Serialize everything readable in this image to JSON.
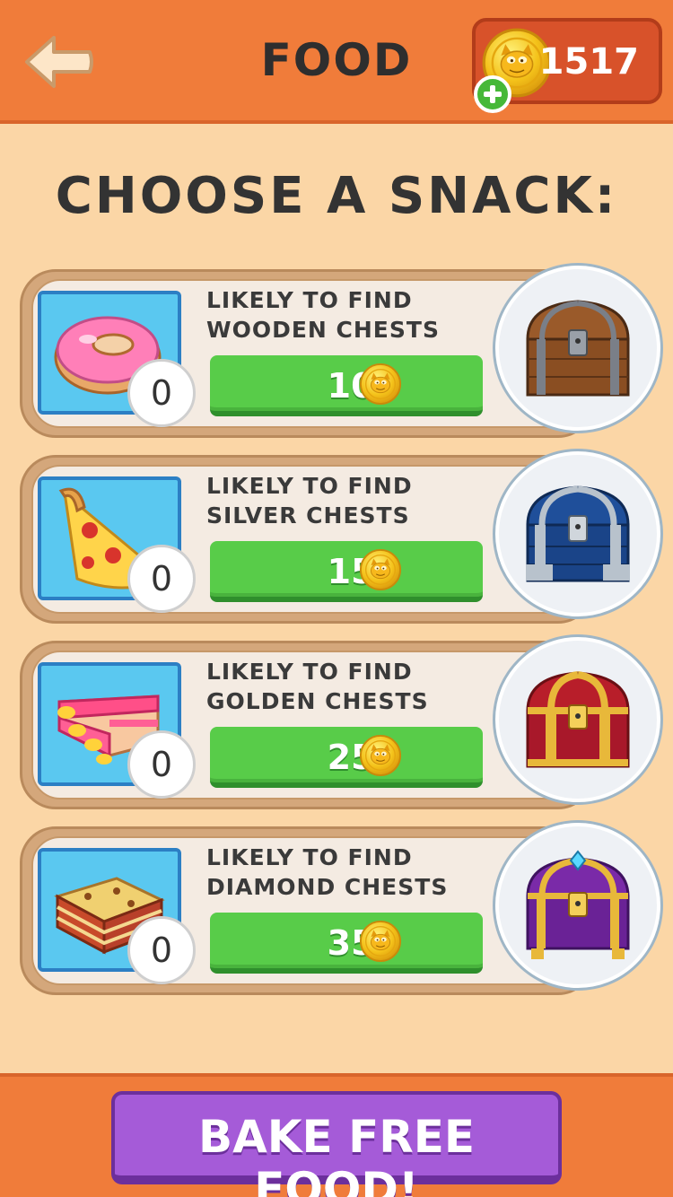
{
  "header": {
    "title": "FOOD",
    "coins": "1517",
    "back_icon": "back-arrow-icon",
    "coin_icon": "garfield-coin-icon",
    "add_icon": "plus-icon"
  },
  "heading": "CHOOSE A SNACK:",
  "snacks": [
    {
      "food": "donut",
      "count": "0",
      "line1": "LIKELY TO FIND",
      "line2": "WOODEN CHESTS",
      "price": "100",
      "chest": "wooden-chest"
    },
    {
      "food": "pizza",
      "count": "0",
      "line1": "LIKELY TO FIND",
      "line2": "SILVER CHESTS",
      "price": "150",
      "chest": "silver-chest"
    },
    {
      "food": "cake",
      "count": "0",
      "line1": "LIKELY TO FIND",
      "line2": "GOLDEN CHESTS",
      "price": "250",
      "chest": "golden-chest"
    },
    {
      "food": "lasagna",
      "count": "0",
      "line1": "LIKELY TO FIND",
      "line2": "DIAMOND CHESTS",
      "price": "350",
      "chest": "diamond-chest"
    }
  ],
  "footer": {
    "bake_label": "BAKE FREE FOOD!"
  },
  "colors": {
    "header_bg": "#f07c3a",
    "page_bg": "#fbd6a6",
    "buy_button": "#58cc49",
    "bake_button": "#a55bd8"
  }
}
